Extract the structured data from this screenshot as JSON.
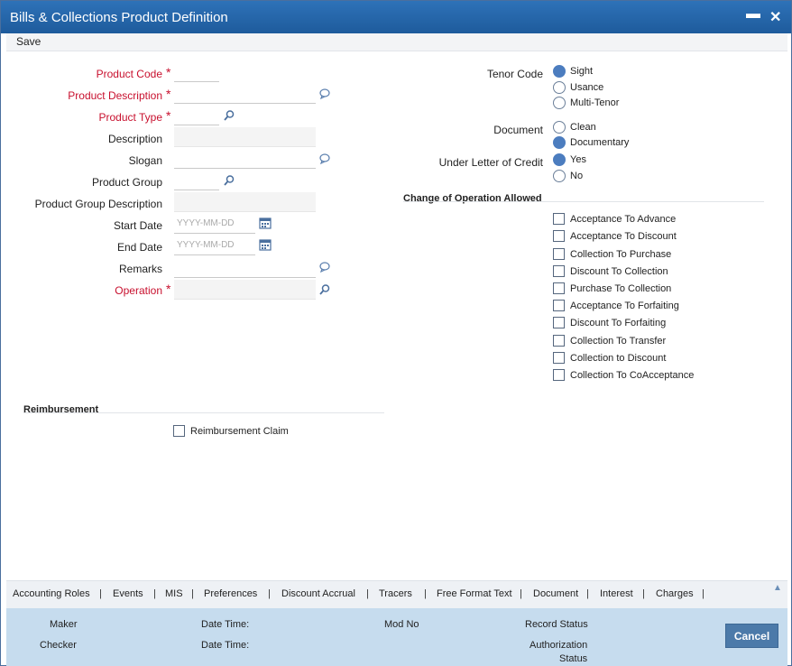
{
  "window": {
    "title": "Bills & Collections Product Definition",
    "minimize": "▬",
    "close": "✕"
  },
  "toolbar": {
    "save": "Save"
  },
  "form": {
    "product_code": {
      "label": "Product Code",
      "value": ""
    },
    "product_description": {
      "label": "Product Description",
      "value": ""
    },
    "product_type": {
      "label": "Product Type",
      "value": ""
    },
    "description": {
      "label": "Description",
      "value": ""
    },
    "slogan": {
      "label": "Slogan",
      "value": ""
    },
    "product_group": {
      "label": "Product Group",
      "value": ""
    },
    "product_group_description": {
      "label": "Product Group Description",
      "value": ""
    },
    "start_date": {
      "label": "Start Date",
      "placeholder": "YYYY-MM-DD"
    },
    "end_date": {
      "label": "End Date",
      "placeholder": "YYYY-MM-DD"
    },
    "remarks": {
      "label": "Remarks",
      "value": ""
    },
    "operation": {
      "label": "Operation",
      "value": ""
    },
    "required_star": "*"
  },
  "tenor_code": {
    "label": "Tenor Code",
    "options": [
      "Sight",
      "Usance",
      "Multi-Tenor"
    ],
    "selected": "Sight"
  },
  "document": {
    "label": "Document",
    "options": [
      "Clean",
      "Documentary"
    ],
    "selected": "Documentary"
  },
  "under_lc": {
    "label": "Under Letter of Credit",
    "options": [
      "Yes",
      "No"
    ],
    "selected": "Yes"
  },
  "change_of_operation": {
    "title": "Change of Operation Allowed",
    "items": [
      "Acceptance To Advance",
      "Acceptance To Discount",
      "Collection To Purchase",
      "Discount To Collection",
      "Purchase To Collection",
      "Acceptance To Forfaiting",
      "Discount To Forfaiting",
      "Collection To Transfer",
      "Collection to Discount",
      "Collection To CoAcceptance"
    ]
  },
  "reimbursement": {
    "title": "Reimbursement",
    "claim_label": "Reimbursement Claim"
  },
  "tabs": [
    "Accounting Roles",
    "Events",
    "MIS",
    "Preferences",
    "Discount Accrual",
    "Tracers",
    "Free Format Text",
    "Document",
    "Interest",
    "Charges"
  ],
  "tab_separator": "|",
  "footer": {
    "maker": "Maker",
    "checker": "Checker",
    "date_time_1": "Date Time:",
    "date_time_2": "Date Time:",
    "mod_no": "Mod No",
    "record_status": "Record Status",
    "authorization_status_1": "Authorization",
    "authorization_status_2": "Status",
    "cancel": "Cancel"
  },
  "colors": {
    "title_bar": "#1e5b9c",
    "required": "#c8102e",
    "radio_on": "#4c7dbf",
    "footer": "#c6dcee",
    "cancel_button": "#4c7aa9"
  }
}
